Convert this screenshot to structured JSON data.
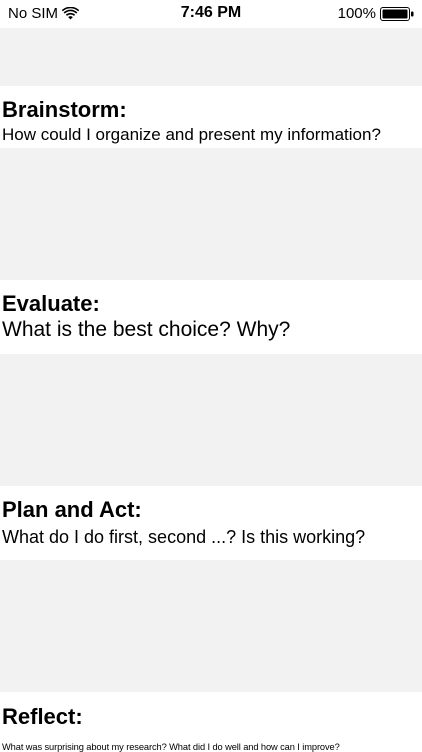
{
  "status_bar": {
    "carrier": "No SIM",
    "time": "7:46 PM",
    "battery": "100%"
  },
  "sections": [
    {
      "title": "Brainstorm:",
      "prompt": "How could I organize and present my information?"
    },
    {
      "title": "Evaluate:",
      "prompt": "What is the best choice? Why?"
    },
    {
      "title": "Plan and Act:",
      "prompt": "What do I do first, second ...? Is this working?"
    },
    {
      "title": "Reflect:",
      "prompt": "What was surprising about my research? What did I do well and how can I improve?"
    }
  ],
  "answer_areas": [
    "",
    "",
    "",
    ""
  ]
}
